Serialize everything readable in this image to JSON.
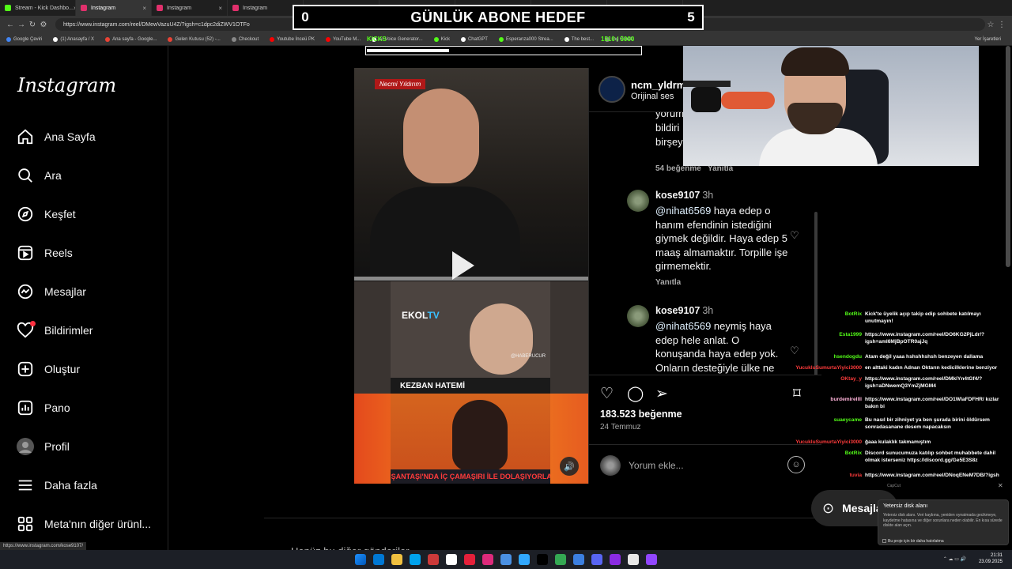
{
  "browser": {
    "tabs": [
      {
        "label": "Stream - Kick Dashbo...",
        "color": "#53fc18",
        "active": false
      },
      {
        "label": "Instagram",
        "color": "#e1306c",
        "active": true
      },
      {
        "label": "Instagram",
        "color": "#e1306c",
        "active": false
      },
      {
        "label": "Instagram",
        "color": "#e1306c",
        "active": false
      },
      {
        "label": "Instagram",
        "color": "#e1306c",
        "active": false
      },
      {
        "label": "Instagram",
        "color": "#e1306c",
        "active": false
      },
      {
        "label": "Instagram",
        "color": "#e1306c",
        "active": false
      },
      {
        "label": "Instagram",
        "color": "#e1306c",
        "active": false
      },
      {
        "label": "Instagram",
        "color": "#e1306c",
        "active": false
      }
    ],
    "url": "https://www.instagram.com/reel/DMewVazuU4Z/?igsh=c1dpc2diZWV1OTFo",
    "bookmarks": [
      {
        "label": "Google Çeviri",
        "color": "#4285f4"
      },
      {
        "label": "(1) Anasayfa / X",
        "color": "#ffffff"
      },
      {
        "label": "Ana sayfa - Google...",
        "color": "#ea4335"
      },
      {
        "label": "Gelen Kutusu (52) -...",
        "color": "#ea4335"
      },
      {
        "label": "Checkout",
        "color": "#888888"
      },
      {
        "label": "Youtube İnceü PK",
        "color": "#ff0000"
      },
      {
        "label": "YouTube M...",
        "color": "#ff0000"
      },
      {
        "label": "AI Voice Generator...",
        "color": "#ffffff"
      },
      {
        "label": "Kick",
        "color": "#53fc18"
      },
      {
        "label": "ChatGPT",
        "color": "#ffffff"
      },
      {
        "label": "Esperanza000 Strea...",
        "color": "#53fc18"
      },
      {
        "label": "The best...",
        "color": "#ffffff"
      },
      {
        "label": "İng Örnek",
        "color": "#888888"
      }
    ],
    "bookmarks_right": "Yer İşaretleri",
    "status_url": "https://www.instagram.com/kose9107/"
  },
  "sidebar": {
    "logo": "Instagram",
    "items": [
      {
        "name": "home",
        "label": "Ana Sayfa"
      },
      {
        "name": "search",
        "label": "Ara"
      },
      {
        "name": "explore",
        "label": "Keşfet"
      },
      {
        "name": "reels",
        "label": "Reels"
      },
      {
        "name": "messages",
        "label": "Mesajlar"
      },
      {
        "name": "notifications",
        "label": "Bildirimler"
      },
      {
        "name": "create",
        "label": "Oluştur"
      },
      {
        "name": "dashboard",
        "label": "Pano"
      },
      {
        "name": "profile",
        "label": "Profil"
      },
      {
        "name": "more",
        "label": "Daha fazla"
      },
      {
        "name": "meta",
        "label": "Meta'nın diğer ürünl..."
      }
    ]
  },
  "post": {
    "video": {
      "badge": "Necmi Yıldırım",
      "ekol": "EKOL",
      "ekol_suffix": "TV",
      "handle": "@HABERUCUR",
      "caption_name": "KEZBAN HATEMİ",
      "banner": "NİŞANTAŞI'NDA İÇ ÇAMAŞIRI İLE DOLAŞIYORLAR"
    },
    "author": {
      "username": "ncm_yldrm",
      "audio": "Orijinal ses"
    },
    "prev_comment_lines": [
      "yorum",
      "bildiri",
      "birşey"
    ],
    "prev_comment_likes": "54 beğenme",
    "prev_comment_reply": "Yanıtla",
    "comments": [
      {
        "user": "kose9107",
        "time": "3h",
        "mention": "@nihat6569",
        "text": " haya edep o hanım efendinin istediğini giymek değildir. Haya edep 5 maaş almamaktır. Torpille işe girmemektir.",
        "reply": "Yanıtla"
      },
      {
        "user": "kose9107",
        "time": "3h",
        "mention": "@nihat6569",
        "text": " neymiş haya edep hele anlat. O konuşanda haya edep yok. Onların desteğiyle ülke ne",
        "reply": ""
      }
    ],
    "likes": "183.523 beğenme",
    "date": "24 Temmuz",
    "comment_placeholder": "Yorum ekle..."
  },
  "more_posts": "Henüz bu diğer gönderiler",
  "overlay": {
    "goal_left": "0",
    "goal_title": "GÜNLÜK ABONE HEDEF",
    "goal_right": "5",
    "kicks_label": "KICKS",
    "kicks_count": "1510 / 5000",
    "kicks_progress": 0.302
  },
  "chat": [
    {
      "user": "BotRix",
      "color": "#53fc18",
      "text": "Kick'te üyelik açıp takip edip sohbete katılmayı unutmayın!"
    },
    {
      "user": "Esta1999",
      "color": "#53fc18",
      "text": "https://www.instagram.com/reel/DO6KG2PjLdr/?igsh=aml6MjBpOTR0ajJq"
    },
    {
      "user": "hsendogdu",
      "color": "#53fc18",
      "text": "Atam değil yaaa hshshhshsh benzeyen dallama"
    },
    {
      "user": "YucukluSumurtaYiyici3000",
      "color": "#ff3b3b",
      "text": "en alttaki kadın Adnan Oktarın kedicilklerine benziyor"
    },
    {
      "user": "OKtay_y",
      "color": "#ff3b3b",
      "text": "https://www.instagram.com/reel/DMklYn4tGf4/?igsh=aDNwemQ3YmZjMGM4"
    },
    {
      "user": "burdemirellll",
      "color": "#ffb3d9",
      "text": "https://www.instagram.com/reel/DO1WIaFDFHR/ kızlar bakın bi"
    },
    {
      "user": "suaeycame",
      "color": "#53fc18",
      "text": "Bu nasıl bir zihniyet ya ben şurada birini öldürsem sonradasanane desem napacaksın"
    },
    {
      "user": "YucukluSumurtaYiyici3000",
      "color": "#ff3b3b",
      "text": "ğaaa kulaklık takmamıştım"
    },
    {
      "user": "BotRix",
      "color": "#53fc18",
      "text": "Discord sunucumuza katılıp sohbet muhabbete dahil olmak isterseniz https://discord.gg/Ge5E3S8z"
    },
    {
      "user": "tuvia",
      "color": "#ff3b3b",
      "text": "https://www.instagram.com/reel/DNoqENeM7DB/?igsh"
    }
  ],
  "messages_pill": "Mesajlar",
  "toast": {
    "app": "CapCut",
    "title": "Yetersiz disk alanı",
    "body": "Yetersiz disk alanı. Veri kaybına, yeniden oynatmada gecikmeye, kaydetme hatasına ve diğer sorunlara neden olabilir. En kısa sürede diskte alan açın.",
    "checkbox": "Bu proje için bir daha hatırlatma"
  },
  "taskbar": {
    "time": "21:31",
    "date": "23.09.2025",
    "icons": [
      "#0078d4",
      "#f0c040",
      "#00a2ed",
      "#cc3a3a",
      "#ffffff",
      "#e5203a",
      "#dd2a7b",
      "#4a90e2",
      "#31a8ff",
      "#000000",
      "#34a853",
      "#3c7fe0",
      "#5865f2",
      "#8a2be2",
      "#e8e8e8",
      "#9146ff"
    ]
  }
}
